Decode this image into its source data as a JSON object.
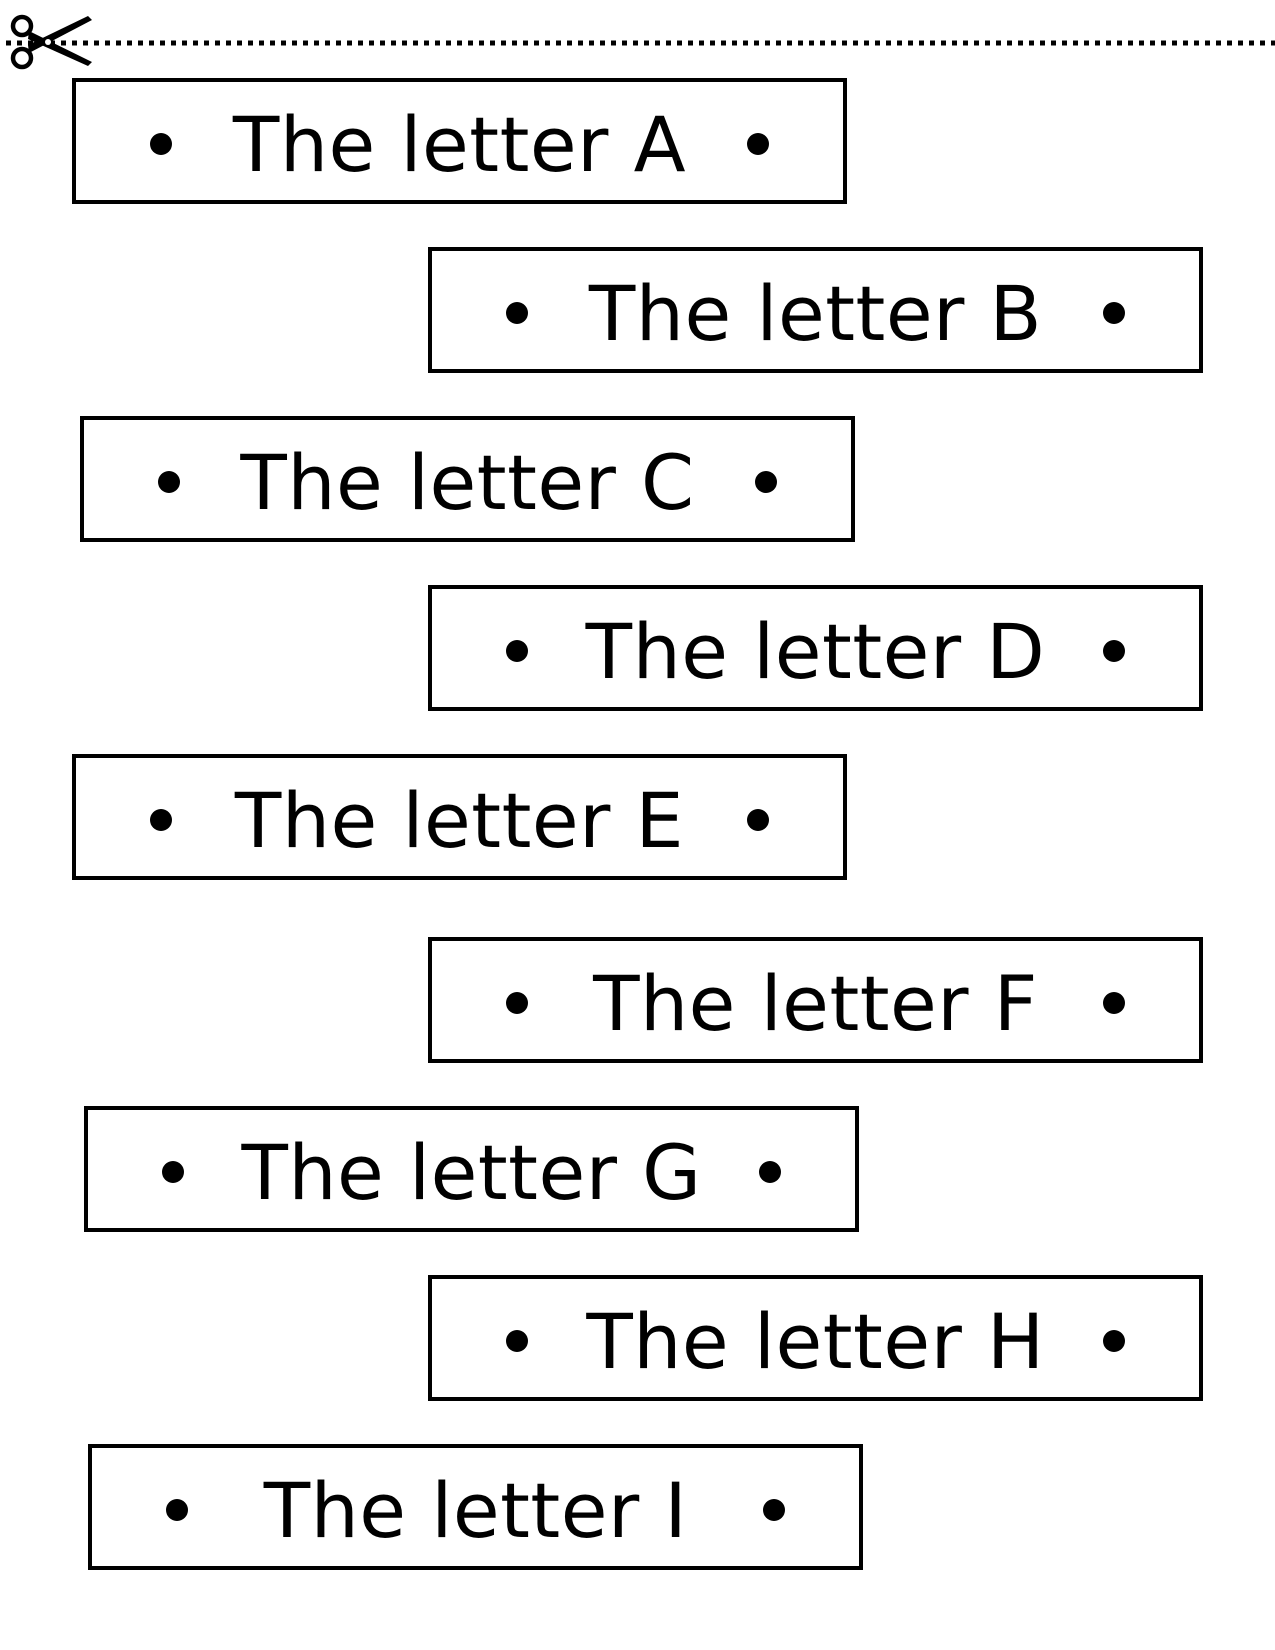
{
  "cut_line": {
    "icon": "scissors-icon",
    "style": "dotted"
  },
  "strips": [
    {
      "label": "The letter A"
    },
    {
      "label": "The letter B"
    },
    {
      "label": "The letter C"
    },
    {
      "label": "The letter D"
    },
    {
      "label": "The letter E"
    },
    {
      "label": "The letter F"
    },
    {
      "label": "The letter G"
    },
    {
      "label": "The letter H"
    },
    {
      "label": "The letter I"
    }
  ],
  "colors": {
    "ink": "#000000",
    "paper": "#ffffff"
  }
}
